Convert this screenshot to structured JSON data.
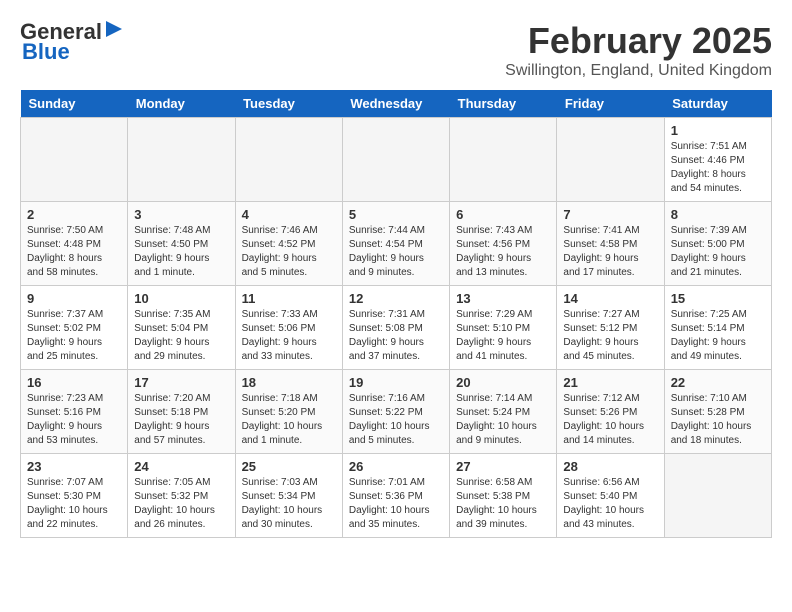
{
  "header": {
    "logo_line1": "General",
    "logo_line2": "Blue",
    "month": "February 2025",
    "location": "Swillington, England, United Kingdom"
  },
  "weekdays": [
    "Sunday",
    "Monday",
    "Tuesday",
    "Wednesday",
    "Thursday",
    "Friday",
    "Saturday"
  ],
  "weeks": [
    [
      {
        "day": "",
        "info": "",
        "empty": true
      },
      {
        "day": "",
        "info": "",
        "empty": true
      },
      {
        "day": "",
        "info": "",
        "empty": true
      },
      {
        "day": "",
        "info": "",
        "empty": true
      },
      {
        "day": "",
        "info": "",
        "empty": true
      },
      {
        "day": "",
        "info": "",
        "empty": true
      },
      {
        "day": "1",
        "info": "Sunrise: 7:51 AM\nSunset: 4:46 PM\nDaylight: 8 hours and 54 minutes."
      }
    ],
    [
      {
        "day": "2",
        "info": "Sunrise: 7:50 AM\nSunset: 4:48 PM\nDaylight: 8 hours and 58 minutes."
      },
      {
        "day": "3",
        "info": "Sunrise: 7:48 AM\nSunset: 4:50 PM\nDaylight: 9 hours and 1 minute."
      },
      {
        "day": "4",
        "info": "Sunrise: 7:46 AM\nSunset: 4:52 PM\nDaylight: 9 hours and 5 minutes."
      },
      {
        "day": "5",
        "info": "Sunrise: 7:44 AM\nSunset: 4:54 PM\nDaylight: 9 hours and 9 minutes."
      },
      {
        "day": "6",
        "info": "Sunrise: 7:43 AM\nSunset: 4:56 PM\nDaylight: 9 hours and 13 minutes."
      },
      {
        "day": "7",
        "info": "Sunrise: 7:41 AM\nSunset: 4:58 PM\nDaylight: 9 hours and 17 minutes."
      },
      {
        "day": "8",
        "info": "Sunrise: 7:39 AM\nSunset: 5:00 PM\nDaylight: 9 hours and 21 minutes."
      }
    ],
    [
      {
        "day": "9",
        "info": "Sunrise: 7:37 AM\nSunset: 5:02 PM\nDaylight: 9 hours and 25 minutes."
      },
      {
        "day": "10",
        "info": "Sunrise: 7:35 AM\nSunset: 5:04 PM\nDaylight: 9 hours and 29 minutes."
      },
      {
        "day": "11",
        "info": "Sunrise: 7:33 AM\nSunset: 5:06 PM\nDaylight: 9 hours and 33 minutes."
      },
      {
        "day": "12",
        "info": "Sunrise: 7:31 AM\nSunset: 5:08 PM\nDaylight: 9 hours and 37 minutes."
      },
      {
        "day": "13",
        "info": "Sunrise: 7:29 AM\nSunset: 5:10 PM\nDaylight: 9 hours and 41 minutes."
      },
      {
        "day": "14",
        "info": "Sunrise: 7:27 AM\nSunset: 5:12 PM\nDaylight: 9 hours and 45 minutes."
      },
      {
        "day": "15",
        "info": "Sunrise: 7:25 AM\nSunset: 5:14 PM\nDaylight: 9 hours and 49 minutes."
      }
    ],
    [
      {
        "day": "16",
        "info": "Sunrise: 7:23 AM\nSunset: 5:16 PM\nDaylight: 9 hours and 53 minutes."
      },
      {
        "day": "17",
        "info": "Sunrise: 7:20 AM\nSunset: 5:18 PM\nDaylight: 9 hours and 57 minutes."
      },
      {
        "day": "18",
        "info": "Sunrise: 7:18 AM\nSunset: 5:20 PM\nDaylight: 10 hours and 1 minute."
      },
      {
        "day": "19",
        "info": "Sunrise: 7:16 AM\nSunset: 5:22 PM\nDaylight: 10 hours and 5 minutes."
      },
      {
        "day": "20",
        "info": "Sunrise: 7:14 AM\nSunset: 5:24 PM\nDaylight: 10 hours and 9 minutes."
      },
      {
        "day": "21",
        "info": "Sunrise: 7:12 AM\nSunset: 5:26 PM\nDaylight: 10 hours and 14 minutes."
      },
      {
        "day": "22",
        "info": "Sunrise: 7:10 AM\nSunset: 5:28 PM\nDaylight: 10 hours and 18 minutes."
      }
    ],
    [
      {
        "day": "23",
        "info": "Sunrise: 7:07 AM\nSunset: 5:30 PM\nDaylight: 10 hours and 22 minutes."
      },
      {
        "day": "24",
        "info": "Sunrise: 7:05 AM\nSunset: 5:32 PM\nDaylight: 10 hours and 26 minutes."
      },
      {
        "day": "25",
        "info": "Sunrise: 7:03 AM\nSunset: 5:34 PM\nDaylight: 10 hours and 30 minutes."
      },
      {
        "day": "26",
        "info": "Sunrise: 7:01 AM\nSunset: 5:36 PM\nDaylight: 10 hours and 35 minutes."
      },
      {
        "day": "27",
        "info": "Sunrise: 6:58 AM\nSunset: 5:38 PM\nDaylight: 10 hours and 39 minutes."
      },
      {
        "day": "28",
        "info": "Sunrise: 6:56 AM\nSunset: 5:40 PM\nDaylight: 10 hours and 43 minutes."
      },
      {
        "day": "",
        "info": "",
        "empty": true
      }
    ]
  ]
}
